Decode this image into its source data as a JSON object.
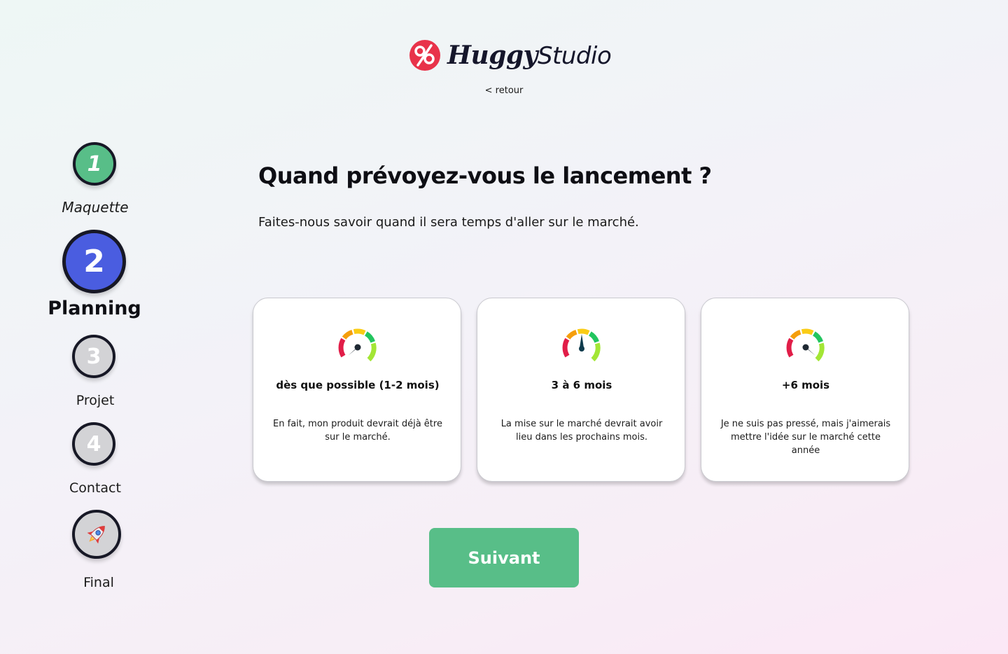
{
  "brand": {
    "logo_strong": "Huggy",
    "logo_light": "Studio",
    "accent": "#e8334a"
  },
  "nav": {
    "back_label": "< retour"
  },
  "steps": [
    {
      "number": "1",
      "label": "Maquette",
      "state": "done",
      "color": "#58be88"
    },
    {
      "number": "2",
      "label": "Planning",
      "state": "current",
      "color": "#4a5de0"
    },
    {
      "number": "3",
      "label": "Projet",
      "state": "todo",
      "color": "#d3d3d6"
    },
    {
      "number": "4",
      "label": "Contact",
      "state": "todo",
      "color": "#d3d3d6"
    },
    {
      "icon": "rocket-icon",
      "label": "Final",
      "state": "todo",
      "color": "#d3d3d6"
    }
  ],
  "main": {
    "title": "Quand prévoyez-vous le lancement ?",
    "subtitle": "Faites-nous savoir quand il sera temps d'aller sur le marché."
  },
  "options": [
    {
      "icon": "speedometer-low-icon",
      "title": "dès que possible (1-2 mois)",
      "description": "En fait, mon produit devrait déjà être sur le marché."
    },
    {
      "icon": "speedometer-mid-icon",
      "title": "3 à 6 mois",
      "description": "La mise sur le marché devrait avoir lieu dans les prochains mois."
    },
    {
      "icon": "speedometer-high-icon",
      "title": "+6 mois",
      "description": "Je ne suis pas pressé, mais j'aimerais mettre l'idée sur le marché cette année"
    }
  ],
  "footer": {
    "next_label": "Suivant",
    "next_color": "#58be88"
  }
}
